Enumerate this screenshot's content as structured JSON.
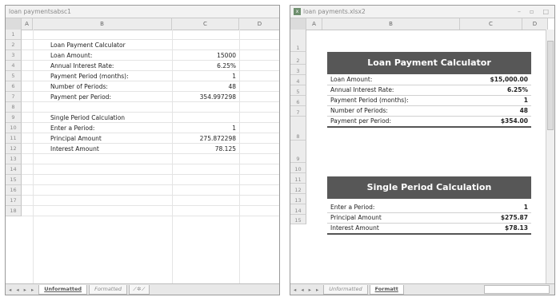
{
  "window1": {
    "title": "loan paymentsabsc1",
    "columns": [
      "A",
      "B",
      "C",
      "D"
    ],
    "rows": [
      {
        "num": "1",
        "label": "",
        "value": ""
      },
      {
        "num": "2",
        "label": "Loan Payment Calculator",
        "value": ""
      },
      {
        "num": "3",
        "label": "Loan Amount:",
        "value": "15000"
      },
      {
        "num": "4",
        "label": "Annual Interest Rate:",
        "value": "6.25%"
      },
      {
        "num": "5",
        "label": "Payment Period (months):",
        "value": "1"
      },
      {
        "num": "6",
        "label": "Number of Periods:",
        "value": "48"
      },
      {
        "num": "7",
        "label": "Payment per Period:",
        "value": "354.997298"
      },
      {
        "num": "8",
        "label": "",
        "value": ""
      },
      {
        "num": "9",
        "label": "Single Period Calculation",
        "value": ""
      },
      {
        "num": "10",
        "label": "Enter a Period:",
        "value": "1"
      },
      {
        "num": "11",
        "label": "Principal Amount",
        "value": "275.872298"
      },
      {
        "num": "12",
        "label": "Interest Amount",
        "value": "78.125"
      },
      {
        "num": "13",
        "label": "",
        "value": ""
      },
      {
        "num": "14",
        "label": "",
        "value": ""
      },
      {
        "num": "15",
        "label": "",
        "value": ""
      },
      {
        "num": "16",
        "label": "",
        "value": ""
      },
      {
        "num": "17",
        "label": "",
        "value": ""
      },
      {
        "num": "18",
        "label": "",
        "value": ""
      }
    ],
    "tabs": {
      "nav": "◂ ◂ ▸ ▸",
      "active": "Unformatted",
      "other": "Formatted",
      "new": "⁄ ✲ ⁄"
    }
  },
  "window2": {
    "title": "loan payments.xlsx2",
    "controls": {
      "minimize": "–",
      "maximize": "▫",
      "close": "□"
    },
    "columns": [
      "A",
      "B",
      "C",
      "D"
    ],
    "row_numbers": [
      "1",
      "2",
      "3",
      "4",
      "5",
      "6",
      "7",
      "8",
      "9",
      "10",
      "11",
      "12",
      "13",
      "14",
      "15"
    ],
    "calc_title": "Loan Payment Calculator",
    "calc_rows": [
      {
        "label": "Loan Amount:",
        "value": "$15,000.00"
      },
      {
        "label": "Annual Interest Rate:",
        "value": "6.25%"
      },
      {
        "label": "Payment Period (months):",
        "value": "1"
      },
      {
        "label": "Number of Periods:",
        "value": "48"
      },
      {
        "label": "Payment per Period:",
        "value": "$354.00"
      }
    ],
    "single_title": "Single Period Calculation",
    "single_rows": [
      {
        "label": "Enter a Period:",
        "value": "1"
      },
      {
        "label": "Principal Amount",
        "value": "$275.87"
      },
      {
        "label": "Interest Amount",
        "value": "$78.13"
      }
    ],
    "tabs": {
      "nav": "◂ ◂ ▸ ▸",
      "first": "Unformatted",
      "active": "Formatt"
    }
  }
}
